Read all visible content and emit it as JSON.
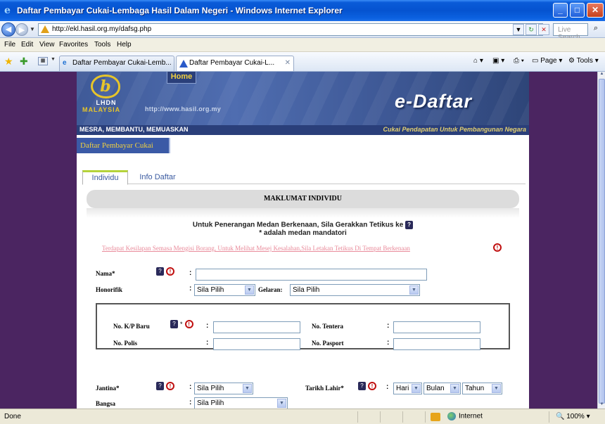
{
  "window": {
    "title": "Daftar Pembayar Cukai-Lembaga Hasil Dalam Negeri - Windows Internet Explorer"
  },
  "address": {
    "url": "http://ekl.hasil.org.my/dafsg.php",
    "search_placeholder": "Live Search"
  },
  "menu": [
    "File",
    "Edit",
    "View",
    "Favorites",
    "Tools",
    "Help"
  ],
  "tabs": [
    {
      "label": "Daftar Pembayar Cukai-Lemb..."
    },
    {
      "label": "Daftar Pembayar Cukai-L..."
    }
  ],
  "commands": {
    "page": "Page",
    "tools": "Tools"
  },
  "banner": {
    "home": "Home",
    "lhdn": "LHDN",
    "malaysia": "MALAYSIA",
    "site": "http://www.hasil.org.my",
    "brand": "e-Daftar",
    "slogan_left": "MESRA, MEMBANTU, MEMUASKAN",
    "slogan_right": "Cukai Pendapatan Untuk Pembangunan Negara",
    "badge": "Daftar Pembayar Cukai"
  },
  "form_tabs": [
    "Individu",
    "Info Daftar"
  ],
  "section_title": "MAKLUMAT INDIVIDU",
  "instructions": {
    "line1": "Untuk Penerangan Medan Berkenaan, Sila Gerakkan Tetikus ke",
    "line2": "* adalah medan mandatori",
    "error": "Terdapat Kesilapan Semasa Mengisi Borang, Untuk Melihat Mesej Kesalahan,Sila Letakan Tetikus Di Tempat Berkenaan"
  },
  "fields": {
    "nama": "Nama*",
    "honorifik": "Honorifik",
    "honorifik_value": "Sila Pilih",
    "gelaran": "Gelaran:",
    "gelaran_value": "Sila Pilih",
    "kp_baru": "No. K/P Baru",
    "polis": "No. Polis",
    "tentera": "No. Tentera",
    "pasport": "No. Pasport",
    "jantina": "Jantina*",
    "jantina_value": "Sila Pilih",
    "tarikh_lahir": "Tarikh Lahir*",
    "hari": "Hari",
    "bulan": "Bulan",
    "tahun": "Tahun",
    "bangsa": "Bangsa",
    "bangsa_value": "Sila Pilih",
    "colon": ":"
  },
  "status": {
    "text": "Done",
    "zone": "Internet",
    "zoom": "100%"
  },
  "icons": {
    "help": "question-icon",
    "warning": "exclamation-circle-icon"
  }
}
